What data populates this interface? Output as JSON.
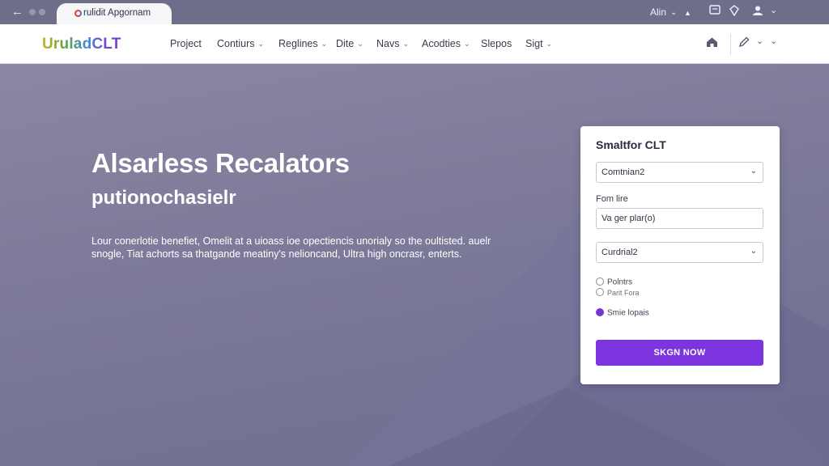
{
  "browser": {
    "tab_title": "rulidit Apgornam",
    "user_name": "Alin",
    "back_icon": "arrow-left-icon"
  },
  "navbar": {
    "logo": "UruladCLT",
    "items": [
      {
        "label": "Project",
        "has_menu": false
      },
      {
        "label": "Contiurs",
        "has_menu": true
      },
      {
        "label": "Reglines",
        "has_menu": true
      },
      {
        "label": "Dite",
        "has_menu": true
      },
      {
        "label": "Navs",
        "has_menu": true
      },
      {
        "label": "Acodties",
        "has_menu": true
      },
      {
        "label": "Slepos",
        "has_menu": false
      },
      {
        "label": "Sigt",
        "has_menu": true
      }
    ]
  },
  "hero": {
    "title": "Alsarless Recalators",
    "subtitle": "putionochasielr",
    "body": "Lour conerlotie benefiet, Omelit at a uioass ioe opectiencis unorialy so the oultisted. auelr snogle, Tiat achorts sa thatgande meatiny's nelioncand, Ultra high oncrasr, enterts."
  },
  "form": {
    "title": "Smaltfor CLT",
    "select1": "Comtnian2",
    "field_label": "Fom lire",
    "field_value": "Va ger plar(o)",
    "select2": "Curdrial2",
    "radios": [
      {
        "label": "Polntrs",
        "checked": false
      },
      {
        "label": "Parit Fora",
        "checked": false
      },
      {
        "label": "Smie lopais",
        "checked": true
      }
    ],
    "submit": "SKGN NOW"
  },
  "colors": {
    "accent": "#7c34de",
    "hero_bg": "#7d7b99",
    "chrome_bg": "#6e6d8a"
  }
}
